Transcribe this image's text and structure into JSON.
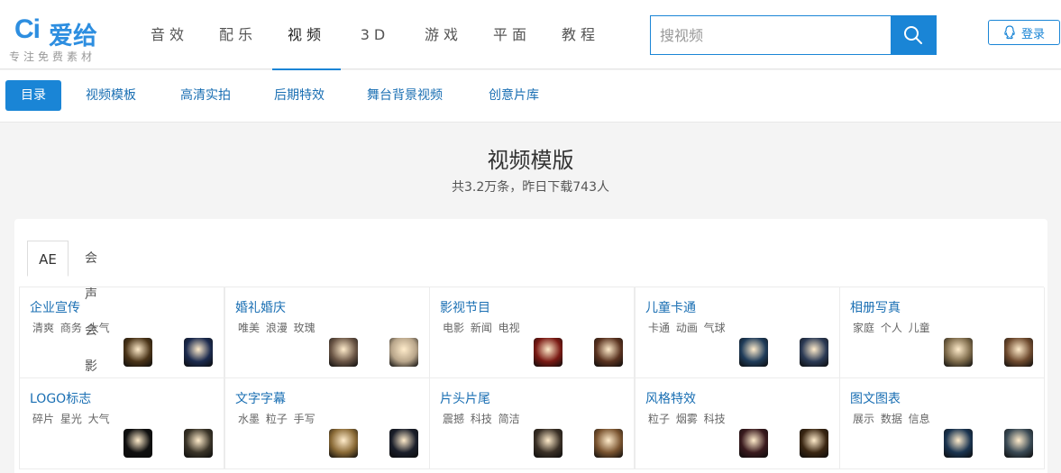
{
  "logo": {
    "mark": "Ci",
    "name": "爱给",
    "tagline": "专注免费素材"
  },
  "nav": [
    {
      "label": "音效",
      "active": false
    },
    {
      "label": "配乐",
      "active": false
    },
    {
      "label": "视频",
      "active": true
    },
    {
      "label": "3D",
      "active": false
    },
    {
      "label": "游戏",
      "active": false
    },
    {
      "label": "平面",
      "active": false
    },
    {
      "label": "教程",
      "active": false
    }
  ],
  "search": {
    "placeholder": "搜视频",
    "value": ""
  },
  "login_label": "登录",
  "subnav": [
    {
      "label": "目录",
      "active": true
    },
    {
      "label": "视频模板",
      "active": false
    },
    {
      "label": "高清实拍",
      "active": false
    },
    {
      "label": "后期特效",
      "active": false
    },
    {
      "label": "舞台背景视频",
      "active": false
    },
    {
      "label": "创意片库",
      "active": false
    }
  ],
  "hero": {
    "title": "视频模版",
    "subtitle": "共3.2万条，昨日下载743人"
  },
  "tabs": [
    {
      "label": "AE",
      "active": true
    },
    {
      "label": "会声会影",
      "active": false
    }
  ],
  "categories": [
    {
      "title": "企业宣传",
      "tags": "清爽 商务 大气",
      "thumbs": [
        "#4a3418",
        "#1b2a4e"
      ]
    },
    {
      "title": "婚礼婚庆",
      "tags": "唯美 浪漫 玫瑰",
      "thumbs": [
        "#6b5646",
        "#b8a58a"
      ]
    },
    {
      "title": "影视节目",
      "tags": "电影 新闻 电视",
      "thumbs": [
        "#7a1a14",
        "#5a3320"
      ]
    },
    {
      "title": "儿童卡通",
      "tags": "卡通 动画 气球",
      "thumbs": [
        "#1f3c5a",
        "#2b3a55"
      ]
    },
    {
      "title": "相册写真",
      "tags": "家庭 个人 儿童",
      "thumbs": [
        "#7d6a4a",
        "#6e4a2e"
      ]
    },
    {
      "title": "LOGO标志",
      "tags": "碎片 星光 大气",
      "thumbs": [
        "#101010",
        "#3a3428"
      ]
    },
    {
      "title": "文字字幕",
      "tags": "水墨 粒子 手写",
      "thumbs": [
        "#8a6a36",
        "#1a1e2a"
      ]
    },
    {
      "title": "片头片尾",
      "tags": "震撼 科技 简洁",
      "thumbs": [
        "#3a3026",
        "#7a5430"
      ]
    },
    {
      "title": "风格特效",
      "tags": "粒子 烟雾 科技",
      "thumbs": [
        "#3a1a1e",
        "#3a2612"
      ]
    },
    {
      "title": "图文图表",
      "tags": "展示 数据 信息",
      "thumbs": [
        "#1a3450",
        "#3a4a55"
      ]
    }
  ],
  "colors": {
    "accent": "#1a85d6",
    "link": "#1a6fb3",
    "page_bg": "#f4f4f4"
  },
  "icons": {
    "search": "search-icon",
    "login": "qq-icon"
  }
}
